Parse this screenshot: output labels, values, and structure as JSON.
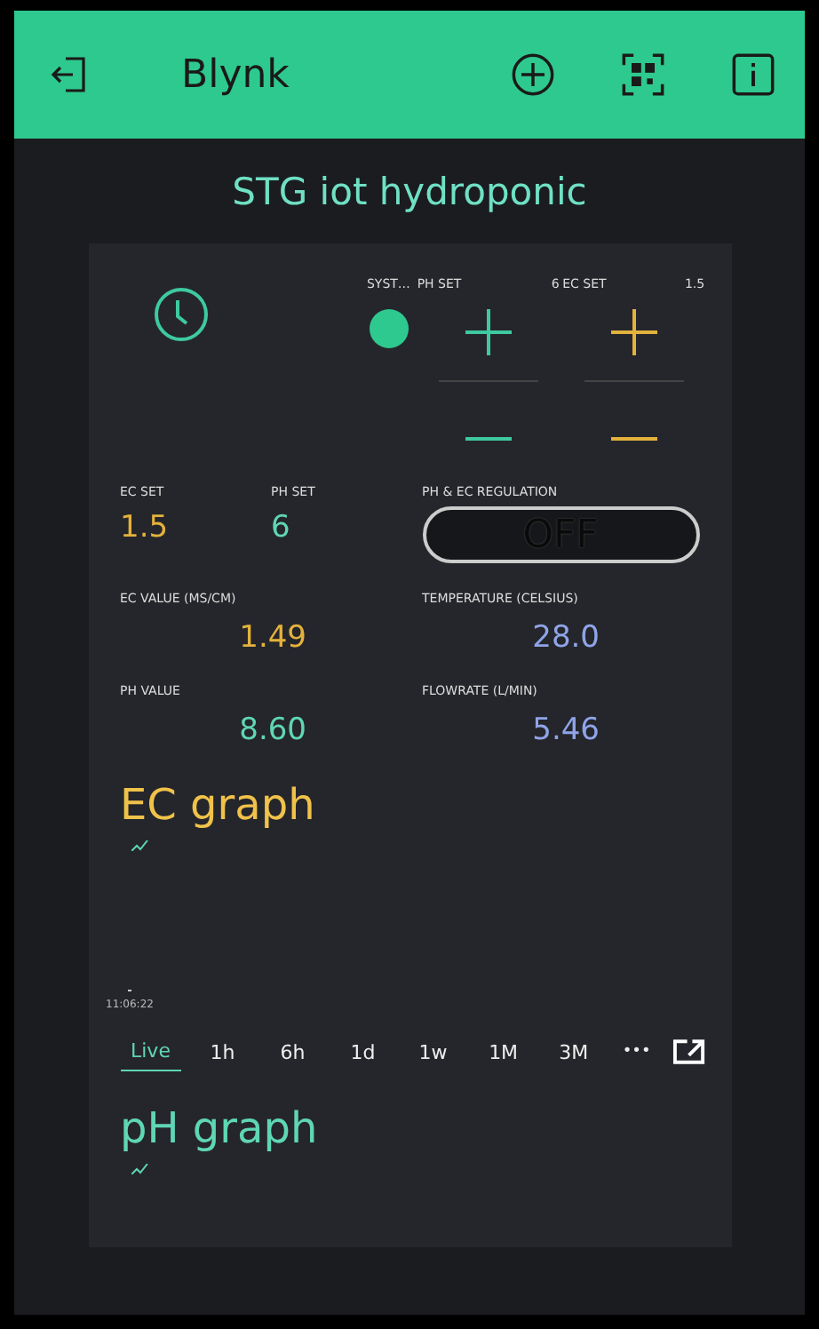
{
  "app_bar": {
    "title": "Blynk"
  },
  "project_title": "STG iot hydroponic",
  "system": {
    "label": "SYST…",
    "on": true
  },
  "steppers": [
    {
      "label": "PH SET",
      "value": "6",
      "color": "#3ec9a0"
    },
    {
      "label": "EC SET",
      "value": "1.5",
      "color": "#e3b23c"
    }
  ],
  "set_displays": [
    {
      "label": "EC SET",
      "value": "1.5",
      "color": "#e3b23c"
    },
    {
      "label": "PH SET",
      "value": "6",
      "color": "#5fd6b4"
    }
  ],
  "regulation": {
    "label": "PH & EC REGULATION",
    "value": "OFF",
    "on": false
  },
  "displays": [
    {
      "label": "EC VALUE (MS/CM)",
      "value": "1.49",
      "color": "#e3b23c"
    },
    {
      "label": "TEMPERATURE (CELSIUS)",
      "value": "28.0",
      "color": "#8fa4e8"
    },
    {
      "label": "PH VALUE",
      "value": "8.60",
      "color": "#5fd6b4"
    },
    {
      "label": "FLOWRATE (L/MIN)",
      "value": "5.46",
      "color": "#8fa4e8"
    }
  ],
  "graphs": [
    {
      "title": "EC graph",
      "color": "#f0c24a",
      "time_label": "11:06:22",
      "periods": [
        {
          "label": "Live",
          "selected": true
        },
        {
          "label": "1h",
          "selected": false
        },
        {
          "label": "6h",
          "selected": false
        },
        {
          "label": "1d",
          "selected": false
        },
        {
          "label": "1w",
          "selected": false
        },
        {
          "label": "1M",
          "selected": false
        },
        {
          "label": "3M",
          "selected": false
        }
      ],
      "more": "•••"
    },
    {
      "title": "pH graph",
      "color": "#5fd6b4"
    }
  ]
}
